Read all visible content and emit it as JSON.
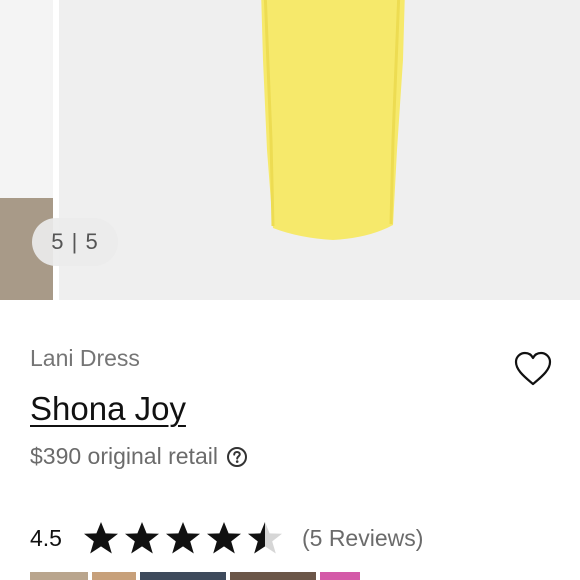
{
  "gallery": {
    "counter": "5 | 5",
    "dress_color": "#f6e96b"
  },
  "product": {
    "model_name": "Lani Dress",
    "brand": "Shona Joy",
    "price_text": "$390 original retail",
    "help_icon": "question-circle-icon",
    "favorite_icon": "heart-outline-icon"
  },
  "rating": {
    "value": "4.5",
    "stars": 4.5,
    "reviews_text": "(5 Reviews)"
  }
}
